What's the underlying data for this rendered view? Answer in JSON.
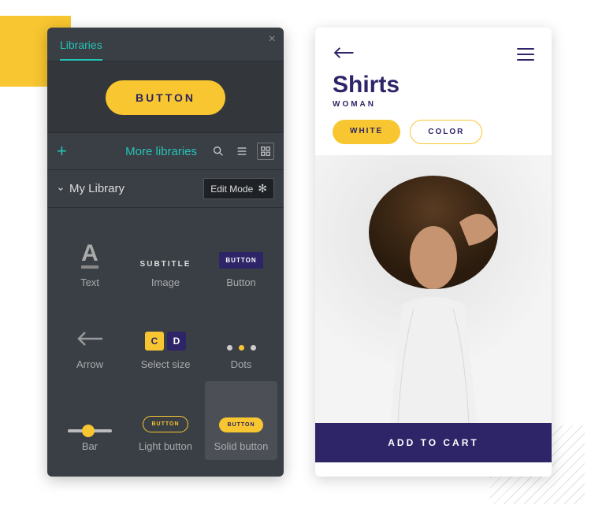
{
  "left_panel": {
    "tab_label": "Libraries",
    "hero_button": "BUTTON",
    "more_link": "More libraries",
    "my_library_label": "My Library",
    "edit_mode_label": "Edit Mode",
    "items": [
      {
        "label": "Text"
      },
      {
        "label": "Image",
        "sample": "SUBTITLE"
      },
      {
        "label": "Button",
        "sample": "BUTTON"
      },
      {
        "label": "Arrow"
      },
      {
        "label": "Select size",
        "c": "C",
        "d": "D"
      },
      {
        "label": "Dots"
      },
      {
        "label": "Bar"
      },
      {
        "label": "Light button",
        "sample": "BUTTON"
      },
      {
        "label": "Solid button",
        "sample": "BUTTON"
      }
    ]
  },
  "phone": {
    "title": "Shirts",
    "subtitle": "WOMAN",
    "chip_white": "WHITE",
    "chip_color": "COLOR",
    "cart_label": "ADD TO CART"
  }
}
